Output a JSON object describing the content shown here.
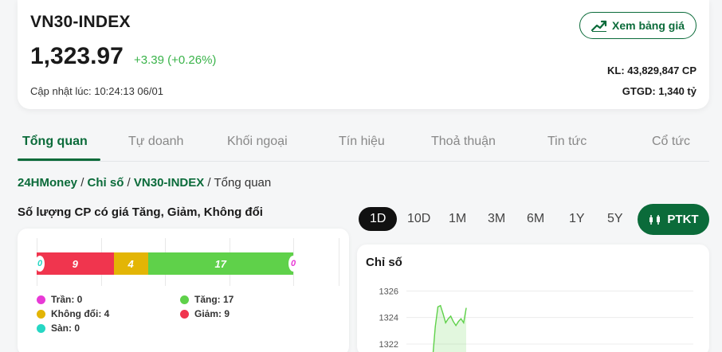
{
  "header": {
    "index_name": "VN30-INDEX",
    "price": "1,323.97",
    "change": "+3.39 (+0.26%)",
    "updated": "Cập nhật lúc: 10:24:13 06/01",
    "board_button": "Xem bảng giá",
    "volume": "KL: 43,829,847 CP",
    "value": "GTGD: 1,340 tỷ"
  },
  "tabs": [
    "Tổng quan",
    "Tự doanh",
    "Khối ngoại",
    "Tín hiệu",
    "Thoả thuận",
    "Tin tức",
    "Cổ tức"
  ],
  "breadcrumb": {
    "items": [
      "24HMoney",
      "Chỉ số",
      "VN30-INDEX"
    ],
    "current": "Tổng quan",
    "sep": " / "
  },
  "breadth": {
    "title": "Số lượng CP có giá Tăng, Giảm, Không đổi",
    "segments": [
      {
        "key": "san",
        "value": 0,
        "label": "0",
        "color": "#26d7c4"
      },
      {
        "key": "giam",
        "value": 9,
        "label": "9",
        "color": "#f0354e"
      },
      {
        "key": "khongdoi",
        "value": 4,
        "label": "4",
        "color": "#e3b505"
      },
      {
        "key": "tang",
        "value": 17,
        "label": "17",
        "color": "#5fd14a"
      },
      {
        "key": "tran",
        "value": 0,
        "label": "0",
        "color": "#e83ad6"
      }
    ],
    "legend": {
      "tran": "Trần: 0",
      "tang": "Tăng: 17",
      "khongdoi": "Không đổi: 4",
      "giam": "Giảm: 9",
      "san": "Sàn: 0"
    }
  },
  "periods": {
    "items": [
      "1D",
      "10D",
      "1M",
      "3M",
      "6M",
      "1Y",
      "5Y"
    ],
    "active": "1D",
    "ptkt": "PTKT"
  },
  "chart_data": {
    "type": "area",
    "title": "Chỉ số",
    "yticks": [
      1326,
      1324,
      1322
    ],
    "ylim": [
      1320.8,
      1326.8
    ],
    "x": [
      0,
      1,
      2,
      3,
      4,
      5,
      6,
      7,
      8,
      9,
      10,
      11,
      12,
      13
    ],
    "values": [
      1321.0,
      1323.3,
      1324.8,
      1324.9,
      1324.3,
      1323.6,
      1323.9,
      1324.1,
      1323.7,
      1323.4,
      1323.7,
      1323.9,
      1323.6,
      1324.7
    ],
    "color": "#5fd14a",
    "grid": true
  },
  "colors": {
    "brand": "#0b6b3a",
    "up": "#3ab34a"
  }
}
